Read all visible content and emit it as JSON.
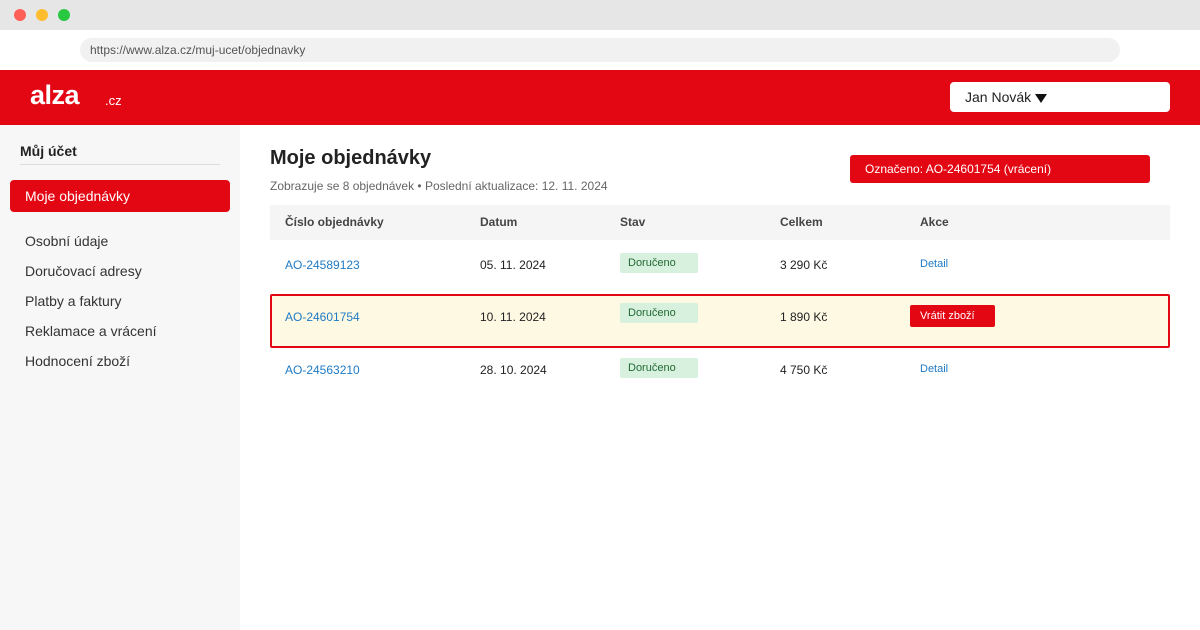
{
  "browser": {
    "url": "https://www.alza.cz/muj-ucet/objednavky"
  },
  "header": {
    "logo": "alza",
    "logo_tld": ".cz",
    "user_name": "Jan Novák"
  },
  "sidebar": {
    "title": "Můj účet",
    "active_item": "Moje objednávky",
    "items": [
      "Osobní údaje",
      "Doručovací adresy",
      "Platby a faktury",
      "Reklamace a vrácení",
      "Hodnocení zboží"
    ]
  },
  "main": {
    "title": "Moje objednávky",
    "subtitle": "Zobrazuje se 8 objednávek • Poslední aktualizace: 12. 11. 2024",
    "marked_banner": "Označeno: AO-24601754 (vrácení)"
  },
  "table": {
    "headers": [
      "Číslo objednávky",
      "Datum",
      "Stav",
      "Celkem",
      "Akce"
    ],
    "rows": [
      {
        "order": "AO-24589123",
        "date": "05. 11. 2024",
        "status": "Doručeno",
        "total": "3 290 Kč",
        "action": "Detail"
      },
      {
        "order": "AO-24601754",
        "date": "10. 11. 2024",
        "status": "Doručeno",
        "total": "1 890 Kč",
        "action": "Vrátit zboží"
      },
      {
        "order": "AO-24563210",
        "date": "28. 10. 2024",
        "status": "Doručeno",
        "total": "4 750 Kč",
        "action": "Detail"
      }
    ]
  },
  "colors": {
    "brand": "#e30613",
    "link": "#1f7ac4",
    "status_bg": "#d8f0de",
    "highlight_bg": "#fef9e3"
  }
}
